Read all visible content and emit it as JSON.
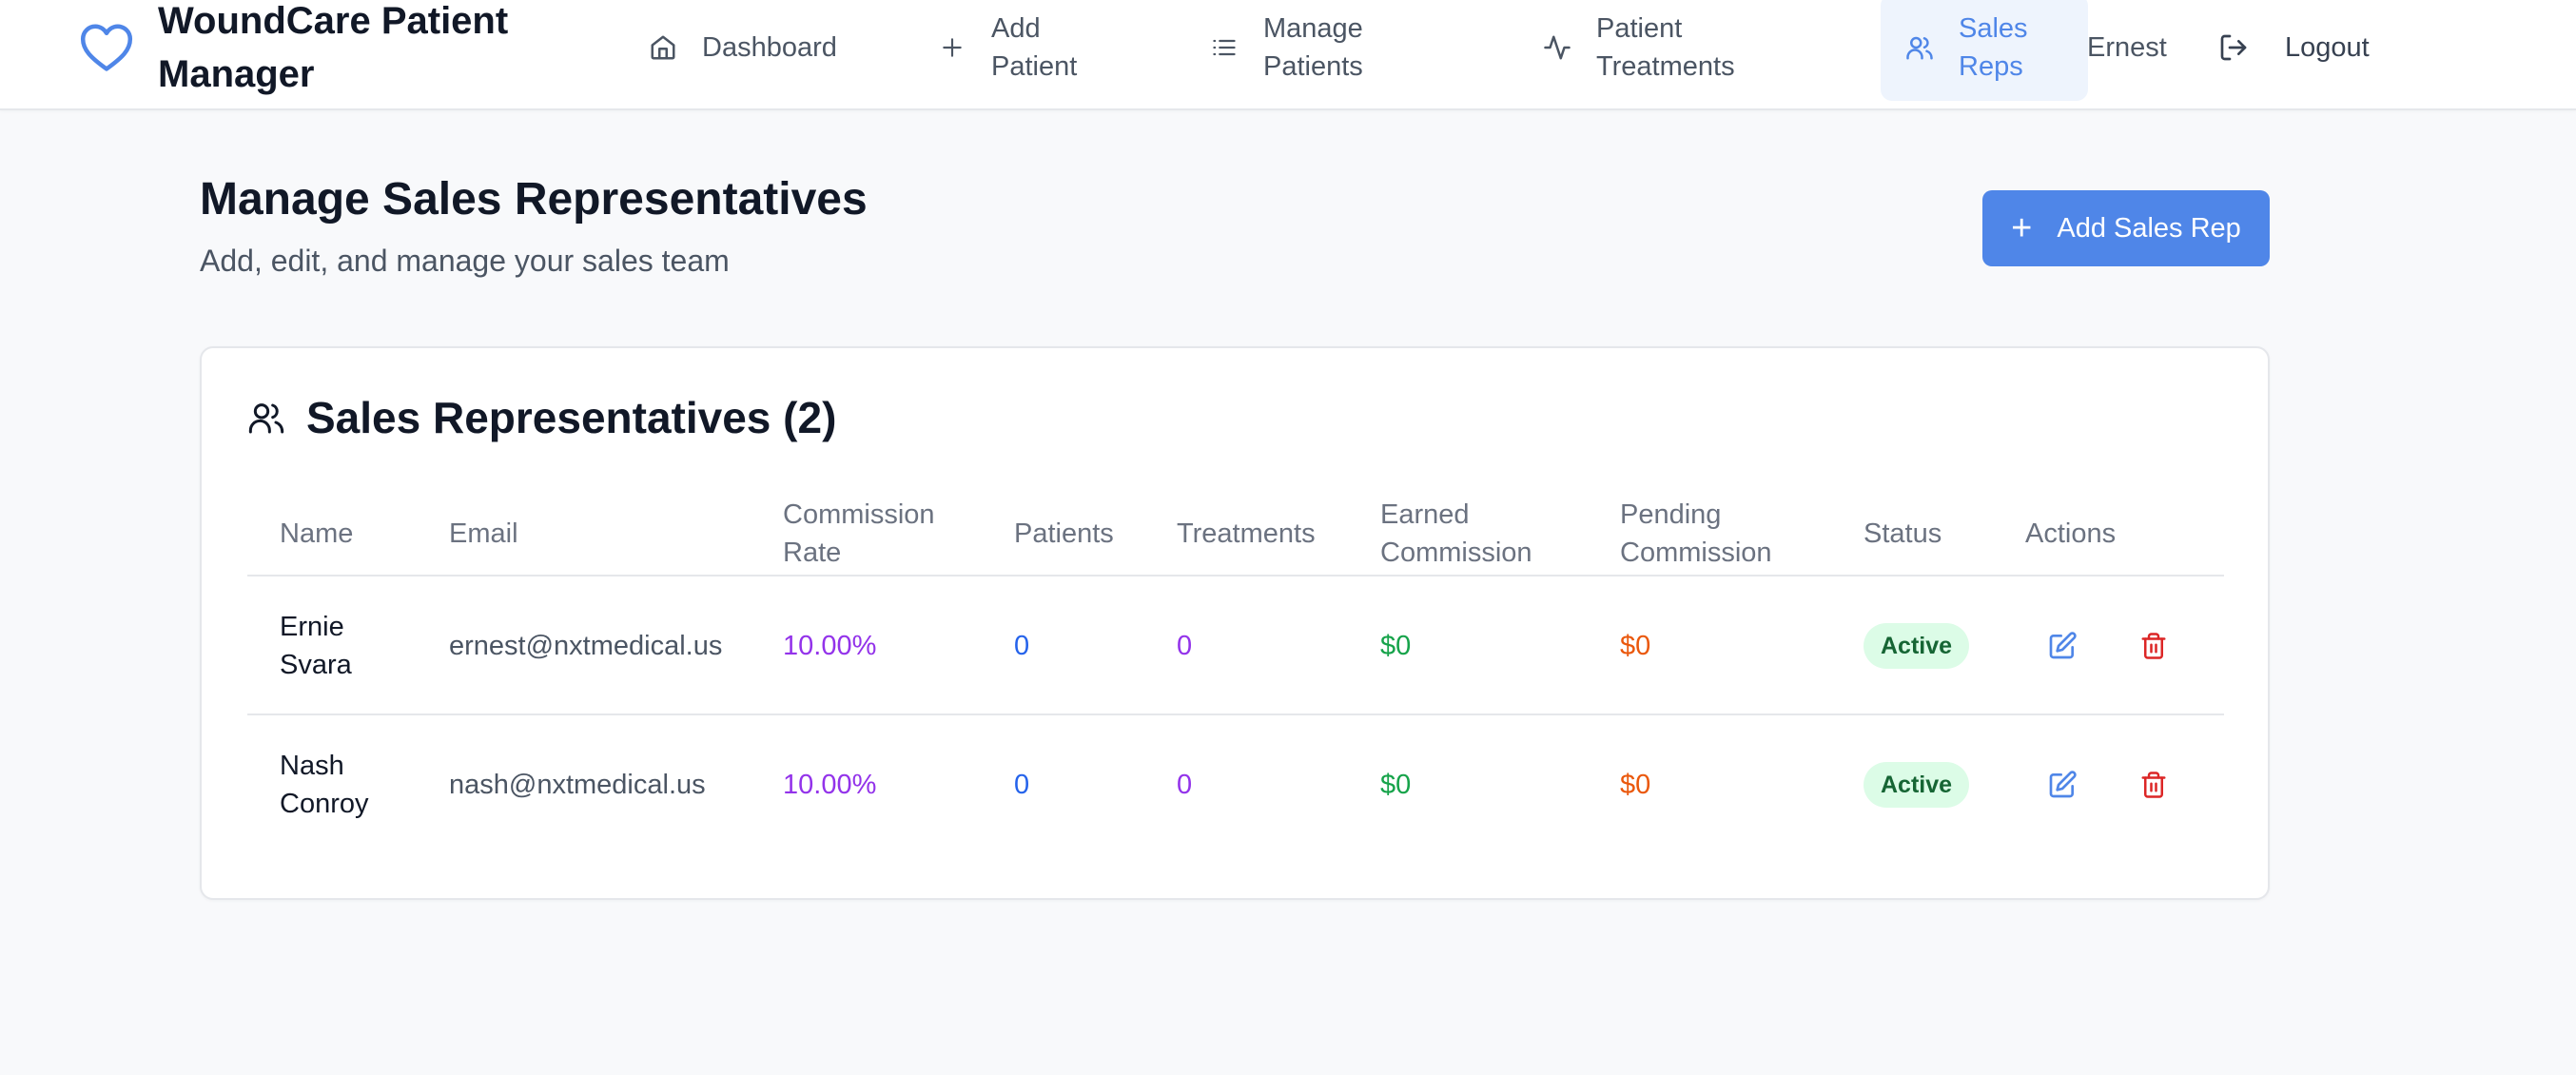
{
  "app": {
    "brand_name": "WoundCare Patient Manager",
    "brand_icon": "heart-icon",
    "accent_color": "#4f86e8"
  },
  "nav": {
    "items": [
      {
        "label": "Dashboard",
        "icon": "home-icon"
      },
      {
        "label": "Add Patient",
        "icon": "plus-icon"
      },
      {
        "label": "Manage Patients",
        "icon": "list-icon"
      },
      {
        "label": "Patient Treatments",
        "icon": "activity-icon"
      },
      {
        "label": "Sales Reps",
        "icon": "users-icon",
        "active": true
      }
    ],
    "user_name": "Ernest",
    "logout_label": "Logout"
  },
  "page": {
    "title": "Manage Sales Representatives",
    "subtitle": "Add, edit, and manage your sales team",
    "add_button_label": "Add Sales Rep"
  },
  "card": {
    "title": "Sales Representatives (2)"
  },
  "table": {
    "headers": {
      "name": "Name",
      "email": "Email",
      "commission_rate": "Commission Rate",
      "patients": "Patients",
      "treatments": "Treatments",
      "earned_commission": "Earned Commission",
      "pending_commission": "Pending Commission",
      "status": "Status",
      "actions": "Actions"
    },
    "rows": [
      {
        "name": "Ernie Svara",
        "email": "ernest@nxtmedical.us",
        "commission_rate": "10.00%",
        "patients": "0",
        "treatments": "0",
        "earned_commission": "$0",
        "pending_commission": "$0",
        "status": "Active"
      },
      {
        "name": "Nash Conroy",
        "email": "nash@nxtmedical.us",
        "commission_rate": "10.00%",
        "patients": "0",
        "treatments": "0",
        "earned_commission": "$0",
        "pending_commission": "$0",
        "status": "Active"
      }
    ]
  }
}
